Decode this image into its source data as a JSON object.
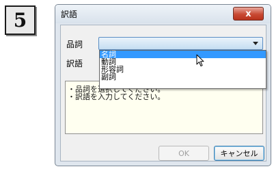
{
  "step": {
    "number": "5"
  },
  "dialog": {
    "title": "訳語",
    "close_label": "x",
    "part_of_speech_label": "品詞",
    "translation_label": "訳語",
    "part_of_speech_value": "",
    "dropdown_options": [
      "名詞",
      "動詞",
      "形容詞",
      "副詞"
    ],
    "selected_option": "名詞",
    "hint_lines": [
      "・品詞を選択してください。",
      "・訳語を入力してください。"
    ],
    "ok_label": "OK",
    "cancel_label": "キャンセル"
  },
  "colors": {
    "selection": "#3399ff",
    "hint_background": "#fffff0",
    "close_button": "#c84a33"
  },
  "icons": {
    "close": "close-icon",
    "dropdown_arrow": "chevron-down-icon",
    "cursor": "mouse-pointer-icon"
  }
}
